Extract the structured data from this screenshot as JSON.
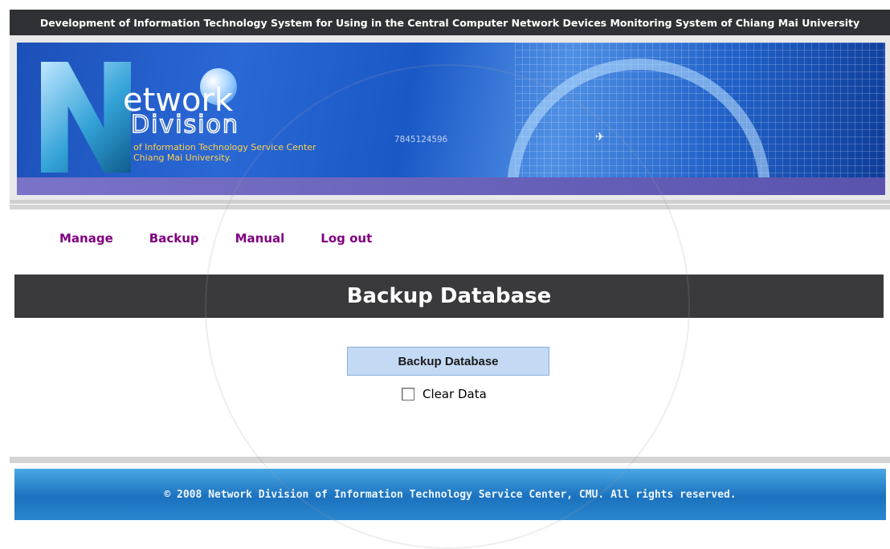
{
  "header": {
    "title": "Development of Information Technology System for Using in the Central Computer Network Devices Monitoring System of Chiang Mai University"
  },
  "banner": {
    "logo_line1": "etwork",
    "logo_line2": "Division",
    "logo_line3": "of Information Technology Service Center",
    "logo_line4": "Chiang Mai University.",
    "digits": "7845124596"
  },
  "nav": {
    "items": [
      "Manage",
      "Backup",
      "Manual",
      "Log out"
    ]
  },
  "main": {
    "title": "Backup Database",
    "backup_button_label": "Backup Database",
    "clear_data_label": "Clear Data",
    "clear_data_checked": false
  },
  "footer": {
    "text": "© 2008 Network Division of Information Technology Service Center, CMU. All rights reserved."
  },
  "colors": {
    "topbar": "#303136",
    "nav_link": "#800080",
    "title_bar": "#3a3a3c",
    "button_bg": "#c4daf4",
    "footer": "#1b72be"
  }
}
